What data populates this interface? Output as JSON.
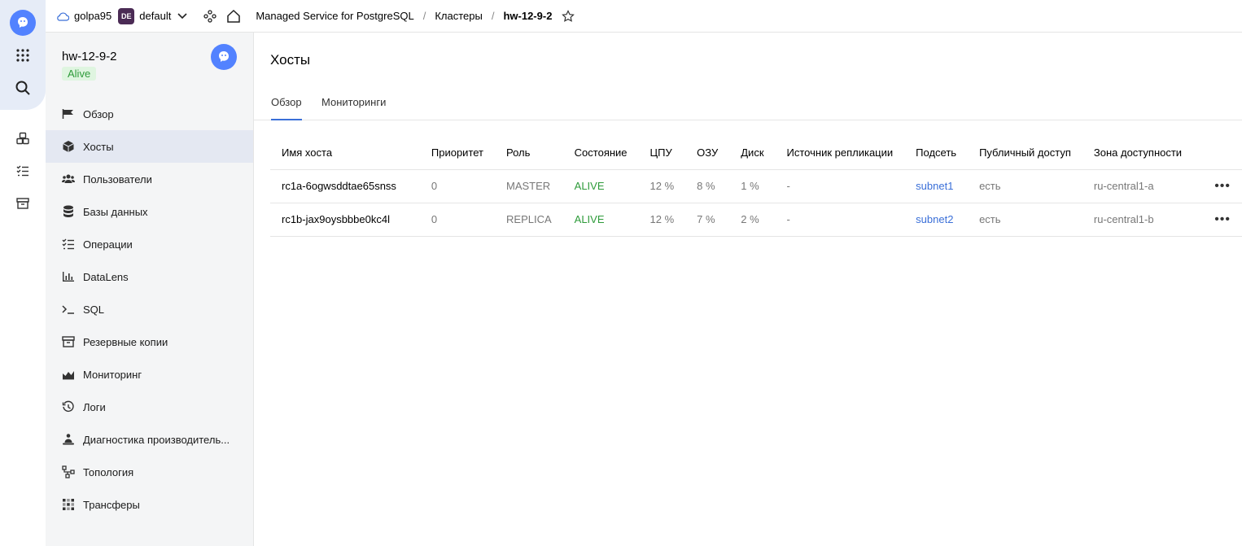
{
  "topbar": {
    "cloud_name": "golpa95",
    "folder_badge": "DE",
    "folder_name": "default",
    "breadcrumb": [
      "Managed Service for PostgreSQL",
      "Кластеры",
      "hw-12-9-2"
    ]
  },
  "sidebar": {
    "cluster_name": "hw-12-9-2",
    "status": "Alive",
    "items": [
      {
        "label": "Обзор",
        "icon": "flag-icon"
      },
      {
        "label": "Хосты",
        "icon": "cube-icon"
      },
      {
        "label": "Пользователи",
        "icon": "users-icon"
      },
      {
        "label": "Базы данных",
        "icon": "database-icon"
      },
      {
        "label": "Операции",
        "icon": "list-check-icon"
      },
      {
        "label": "DataLens",
        "icon": "bar-chart-icon"
      },
      {
        "label": "SQL",
        "icon": "terminal-icon"
      },
      {
        "label": "Резервные копии",
        "icon": "archive-icon"
      },
      {
        "label": "Мониторинг",
        "icon": "area-chart-icon"
      },
      {
        "label": "Логи",
        "icon": "history-icon"
      },
      {
        "label": "Диагностика производитель...",
        "icon": "person-diagnostic-icon"
      },
      {
        "label": "Топология",
        "icon": "topology-icon"
      },
      {
        "label": "Трансферы",
        "icon": "transfer-icon"
      }
    ],
    "active_index": 1
  },
  "main": {
    "title": "Хосты",
    "tabs": [
      "Обзор",
      "Мониторинги"
    ],
    "table": {
      "headers": [
        "Имя хоста",
        "Приоритет",
        "Роль",
        "Состояние",
        "ЦПУ",
        "ОЗУ",
        "Диск",
        "Источник репликации",
        "Подсеть",
        "Публичный доступ",
        "Зона доступности"
      ],
      "rows": [
        [
          "rc1a-6ogwsddtae65snss",
          "0",
          "MASTER",
          "ALIVE",
          "12 %",
          "8 %",
          "1 %",
          "-",
          "subnet1",
          "есть",
          "ru-central1-a"
        ],
        [
          "rc1b-jax9oysbbbe0kc4l",
          "0",
          "REPLICA",
          "ALIVE",
          "12 %",
          "7 %",
          "2 %",
          "-",
          "subnet2",
          "есть",
          "ru-central1-b"
        ]
      ]
    }
  },
  "colors": {
    "accent": "#3a6fd8",
    "alive": "#2e9b3a",
    "brand": "#5282ff"
  }
}
